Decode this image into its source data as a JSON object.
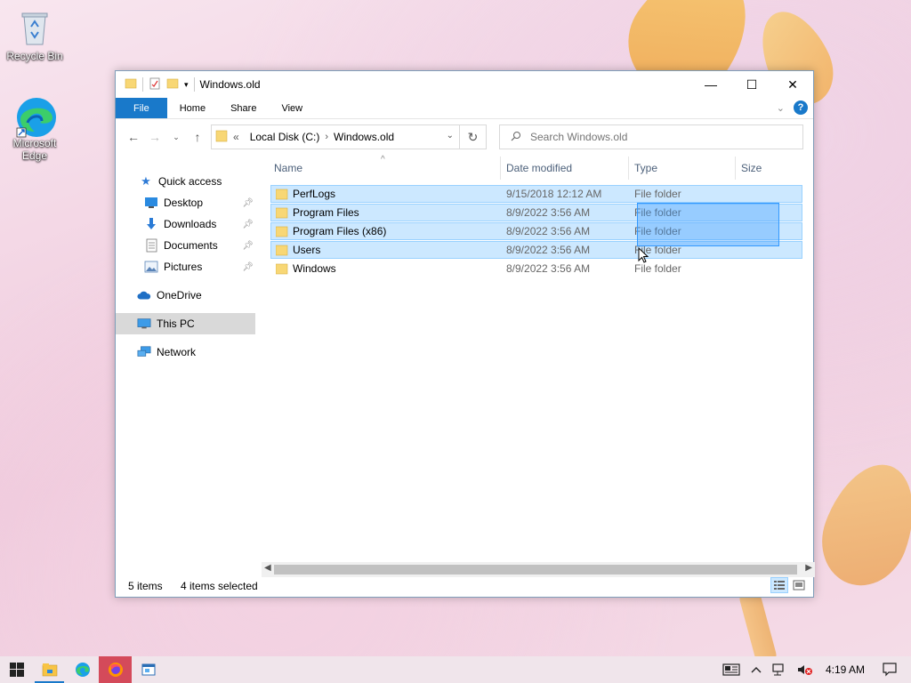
{
  "desktop": {
    "icons": [
      {
        "label": "Recycle Bin"
      },
      {
        "label": "Microsoft Edge"
      }
    ]
  },
  "window": {
    "title": "Windows.old",
    "controls": {
      "minimize": "—",
      "maximize": "☐",
      "close": "✕"
    },
    "ribbon": {
      "tabs": [
        {
          "label": "File"
        },
        {
          "label": "Home"
        },
        {
          "label": "Share"
        },
        {
          "label": "View"
        }
      ],
      "help": "?"
    },
    "address": {
      "overflow": "«",
      "crumbs": [
        "Local Disk (C:)",
        "Windows.old"
      ]
    },
    "search": {
      "placeholder": "Search Windows.old"
    },
    "sidebar": {
      "items": [
        {
          "label": "Quick access"
        },
        {
          "label": "Desktop"
        },
        {
          "label": "Downloads"
        },
        {
          "label": "Documents"
        },
        {
          "label": "Pictures"
        },
        {
          "label": "OneDrive"
        },
        {
          "label": "This PC"
        },
        {
          "label": "Network"
        }
      ]
    },
    "columns": {
      "name": "Name",
      "date": "Date modified",
      "type": "Type",
      "size": "Size"
    },
    "files": [
      {
        "name": "PerfLogs",
        "date": "9/15/2018 12:12 AM",
        "type": "File folder",
        "selected": true
      },
      {
        "name": "Program Files",
        "date": "8/9/2022 3:56 AM",
        "type": "File folder",
        "selected": true
      },
      {
        "name": "Program Files (x86)",
        "date": "8/9/2022 3:56 AM",
        "type": "File folder",
        "selected": true
      },
      {
        "name": "Users",
        "date": "8/9/2022 3:56 AM",
        "type": "File folder",
        "selected": true
      },
      {
        "name": "Windows",
        "date": "8/9/2022 3:56 AM",
        "type": "File folder",
        "selected": false
      }
    ],
    "status": {
      "count": "5 items",
      "selected": "4 items selected"
    }
  },
  "taskbar": {
    "clock": "4:19 AM"
  },
  "colors": {
    "accent": "#1979ca",
    "selection": "#cce8ff",
    "selection_border": "#99d1ff",
    "folder": "#f8d775"
  }
}
